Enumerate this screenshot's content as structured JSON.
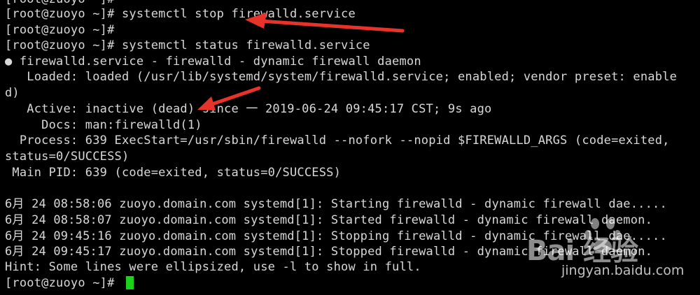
{
  "terminal": {
    "lines": [
      "[root@zuoyo ~]#",
      "[root@zuoyo ~]# systemctl stop firewalld.service",
      "[root@zuoyo ~]#",
      "[root@zuoyo ~]# systemctl status firewalld.service",
      "● firewalld.service - firewalld - dynamic firewall daemon",
      "   Loaded: loaded (/usr/lib/systemd/system/firewalld.service; enabled; vendor preset: enable",
      "d)",
      "   Active: inactive (dead) since 一 2019-06-24 09:45:17 CST; 9s ago",
      "     Docs: man:firewalld(1)",
      "  Process: 639 ExecStart=/usr/sbin/firewalld --nofork --nopid $FIREWALLD_ARGS (code=exited,",
      "status=0/SUCCESS)",
      " Main PID: 639 (code=exited, status=0/SUCCESS)",
      "",
      "6月 24 08:58:06 zuoyo.domain.com systemd[1]: Starting firewalld - dynamic firewall dae.....",
      "6月 24 08:58:07 zuoyo.domain.com systemd[1]: Started firewalld - dynamic firewall daemon.",
      "6月 24 09:45:16 zuoyo.domain.com systemd[1]: Stopping firewalld - dynamic firewall dae.....",
      "6月 24 09:45:17 zuoyo.domain.com systemd[1]: Stopped firewalld - dynamic firewall daemon.",
      "Hint: Some lines were ellipsized, use -l to show in full.",
      "[root@zuoyo ~]#"
    ],
    "cursor_color": "#19d219",
    "annotation_color": "#e8332b"
  },
  "watermark": {
    "logo": "Bai 经验",
    "url": "jingyan.baidu.com"
  }
}
